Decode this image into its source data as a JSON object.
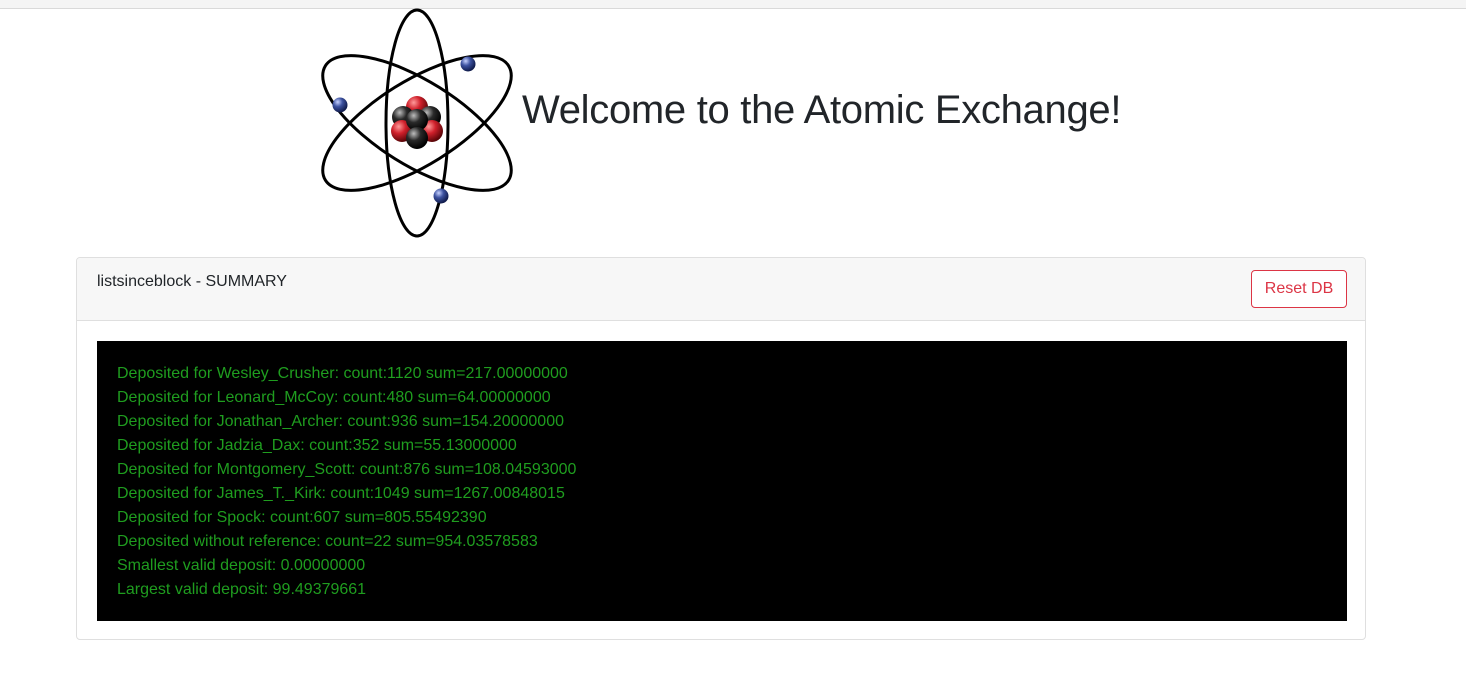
{
  "header": {
    "title": "Welcome to the Atomic Exchange!",
    "logo_icon": "atom-icon"
  },
  "summary_card": {
    "title": "listsinceblock - SUMMARY",
    "reset_button_label": "Reset DB",
    "console_lines": [
      "Deposited for Wesley_Crusher: count:1120 sum=217.00000000",
      "Deposited for Leonard_McCoy: count:480 sum=64.00000000",
      "Deposited for Jonathan_Archer: count:936 sum=154.20000000",
      "Deposited for Jadzia_Dax: count:352 sum=55.13000000",
      "Deposited for Montgomery_Scott: count:876 sum=108.04593000",
      "Deposited for James_T._Kirk: count:1049 sum=1267.00848015",
      "Deposited for Spock: count:607 sum=805.55492390",
      "Deposited without reference: count=22 sum=954.03578583",
      "Smallest valid deposit: 0.00000000",
      "Largest valid deposit: 99.49379661"
    ]
  },
  "colors": {
    "console_background": "#000000",
    "console_text": "#1f9d1f",
    "danger": "#dc3545",
    "nucleus_red": "#c0202a",
    "nucleus_black": "#1a1a1a",
    "electron_blue": "#3a4f9a"
  }
}
